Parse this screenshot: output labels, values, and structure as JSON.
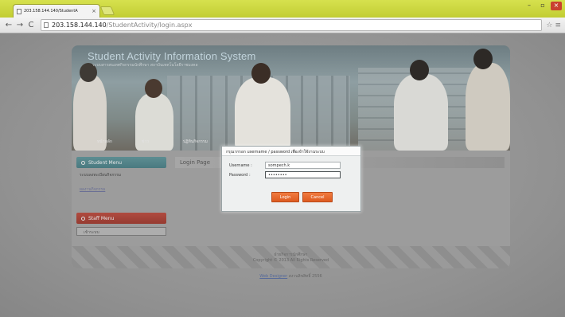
{
  "browser": {
    "tab_title": "203.158.144.140/StudentA",
    "tab_close": "×",
    "url_host": "203.158.144.140",
    "url_path": "/StudentActivity/login.aspx",
    "window_controls": {
      "minimize": "–",
      "maximize": "▫",
      "close": "×"
    },
    "nav": {
      "back": "←",
      "forward": "→",
      "reload": "C"
    },
    "right_icons": {
      "star": "☆",
      "menu": "≡"
    }
  },
  "site": {
    "title": "Student Activity Information System",
    "subtitle": "ระบบสารสนเทศกิจกรรมนักศึกษา สถาบันเทคโนโลยีราชมงคล",
    "banner_nav": [
      "หน้าหลัก",
      "ข่าว",
      "ปฏิทินกิจกรรม"
    ],
    "sidebar": {
      "student_menu": "Student Menu",
      "student_links": [
        "ระบบลงทะเบียนกิจกรรม",
        "ผลงานกิจกรรม"
      ],
      "staff_menu": "Staff Menu",
      "staff_box": "เข้าระบบ"
    },
    "main_title": "Login Page",
    "footer_line1": "ฝ่ายกิจการนักศึกษา",
    "footer_line2": "Copyright © 2013 All Rights Reserved",
    "credit_link": "Web Designer",
    "credit_text": "สงวนลิขสิทธิ์ 2556"
  },
  "dialog": {
    "message": "กรุณากรอก username / password เพื่อเข้าใช้งานระบบ",
    "username_label": "Username :",
    "username_value": "sompech.k",
    "password_label": "Password :",
    "password_value": "password",
    "login_label": "Login",
    "cancel_label": "Cancel"
  },
  "colors": {
    "tabbar": "#c6d13a",
    "student_menu": "#55868b",
    "staff_menu": "#a84438",
    "button": "#e8662c"
  }
}
